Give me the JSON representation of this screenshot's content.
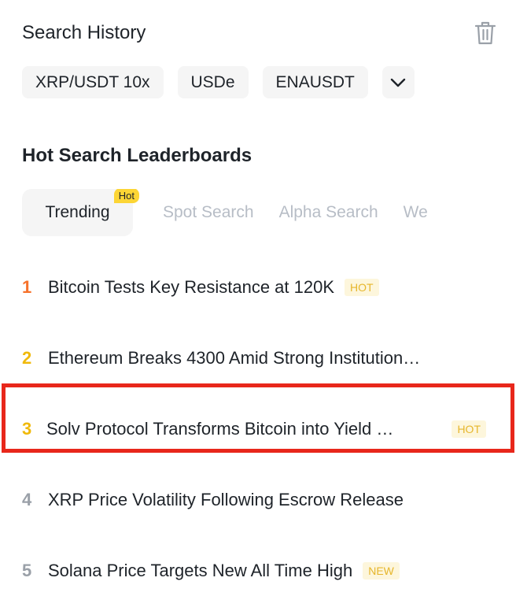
{
  "search_history": {
    "title": "Search History",
    "chips": [
      "XRP/USDT 10x",
      "USDe",
      "ENAUSDT"
    ]
  },
  "leaderboard": {
    "title": "Hot Search Leaderboards",
    "tabs": [
      {
        "label": "Trending",
        "badge": "Hot",
        "active": true
      },
      {
        "label": "Spot Search"
      },
      {
        "label": "Alpha Search"
      },
      {
        "label": "We"
      }
    ],
    "items": [
      {
        "rank": "1",
        "title": "Bitcoin Tests Key Resistance at 120K",
        "tag": "HOT"
      },
      {
        "rank": "2",
        "title": "Ethereum Breaks 4300 Amid Strong Institution…",
        "tag": ""
      },
      {
        "rank": "3",
        "title": "Solv Protocol Transforms Bitcoin into Yield …",
        "tag": "HOT"
      },
      {
        "rank": "4",
        "title": "XRP Price Volatility Following Escrow Release",
        "tag": ""
      },
      {
        "rank": "5",
        "title": "Solana Price Targets New All Time High",
        "tag": "NEW"
      }
    ]
  },
  "colors": {
    "accent": "#fcd535",
    "rank_orange": "#f6722b",
    "rank_gold": "#f0b90b",
    "highlight": "#e8271b"
  },
  "icons": {
    "trash": "trash-icon",
    "expand": "chevron-down-icon"
  }
}
